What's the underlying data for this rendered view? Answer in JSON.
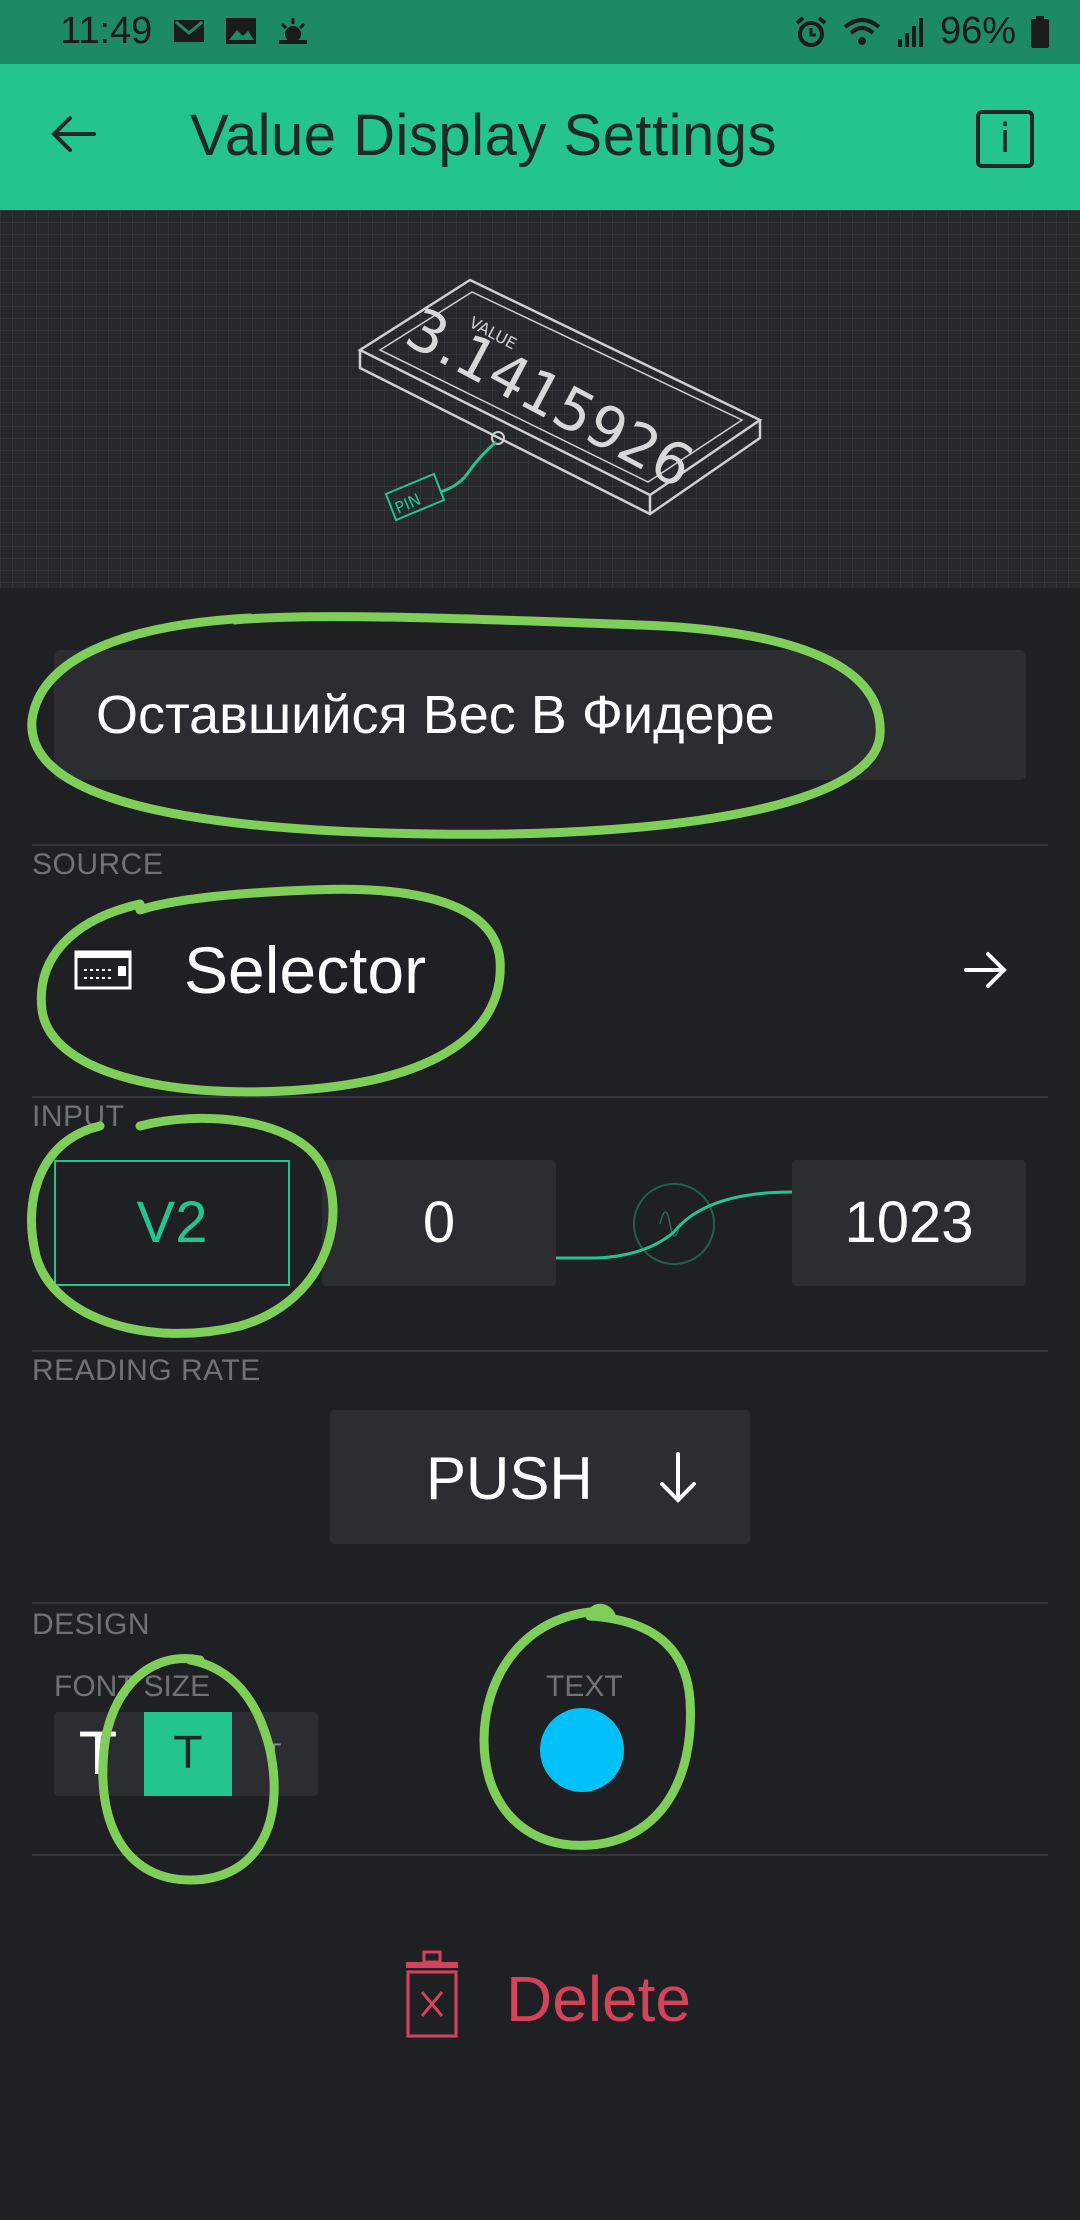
{
  "status_bar": {
    "time": "11:49",
    "battery": "96%",
    "icons": [
      "gmail-icon",
      "gallery-icon",
      "weather-icon",
      "alarm-icon",
      "wifi-icon",
      "signal-icon",
      "battery-icon"
    ]
  },
  "app_bar": {
    "title": "Value Display Settings",
    "info_label": "i"
  },
  "widget": {
    "name": "Оставшийся Вес В Фидере"
  },
  "source": {
    "section_label": "SOURCE",
    "value": "Selector"
  },
  "input": {
    "section_label": "INPUT",
    "pin": "V2",
    "min": "0",
    "max": "1023"
  },
  "reading_rate": {
    "section_label": "READING RATE",
    "value": "PUSH"
  },
  "design": {
    "section_label": "DESIGN",
    "font_size_label": "FONT SIZE",
    "font_sizes": [
      "T",
      "T",
      "T"
    ],
    "selected_font_size_index": 1,
    "text_label": "TEXT",
    "text_color": "#04c0f8"
  },
  "actions": {
    "delete_label": "Delete"
  },
  "colors": {
    "accent": "#23c48e",
    "background": "#1f2023",
    "danger": "#d3435c",
    "annotation": "#7fce5a"
  }
}
